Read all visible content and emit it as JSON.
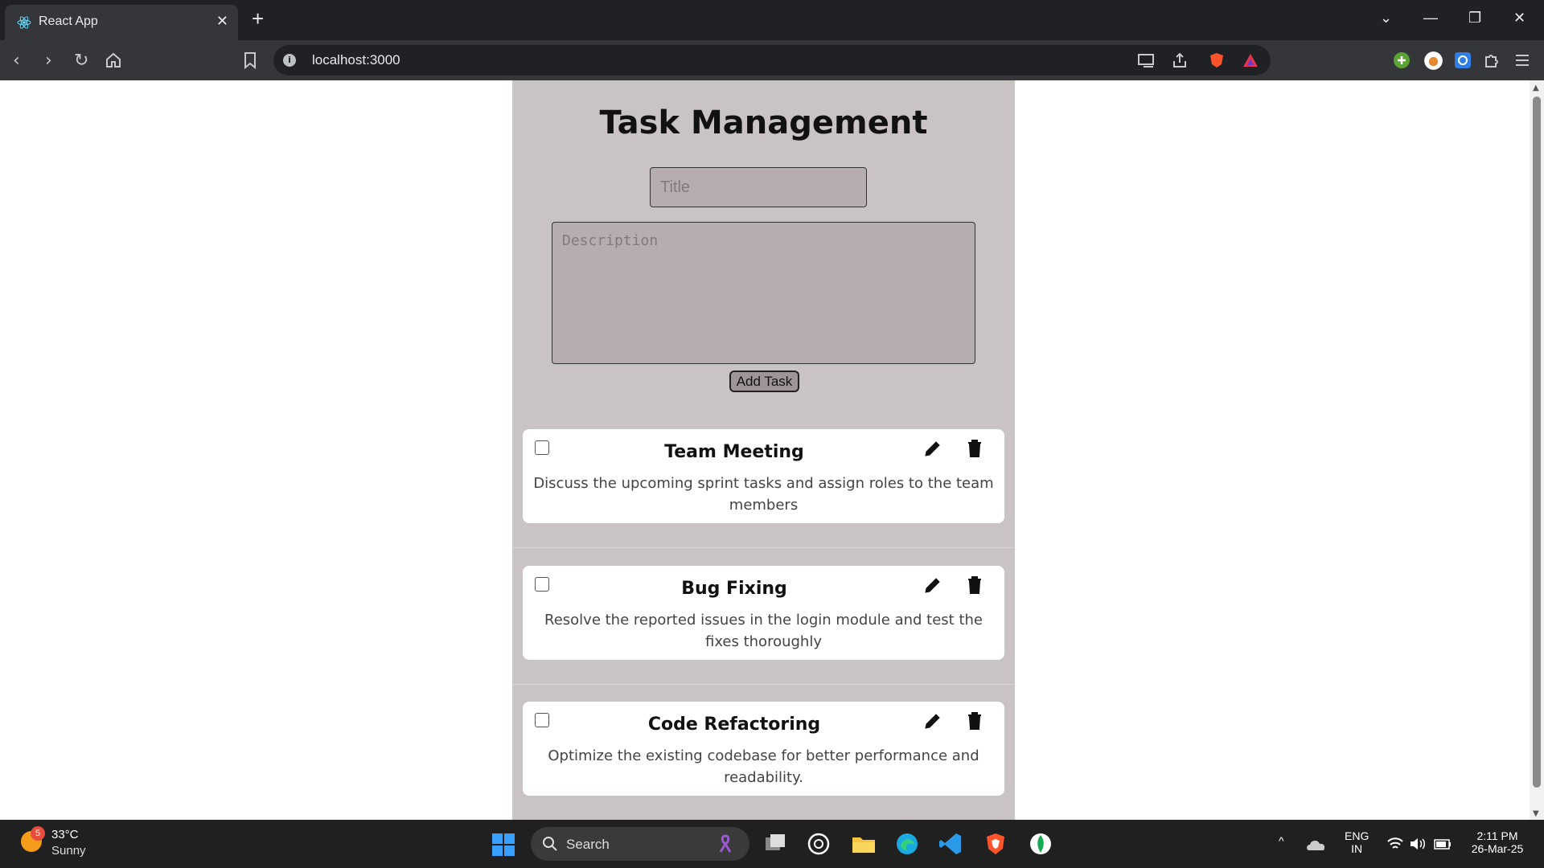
{
  "browser": {
    "tab_title": "React App",
    "tab_close": "✕",
    "new_tab": "+",
    "url": "localhost:3000"
  },
  "app": {
    "heading": "Task Management",
    "title_placeholder": "Title",
    "description_placeholder": "Description",
    "add_button": "Add Task",
    "tasks": [
      {
        "title": "Team Meeting",
        "description": "Discuss the upcoming sprint tasks and assign roles to the team members",
        "completed": false
      },
      {
        "title": "Bug Fixing",
        "description": "Resolve the reported issues in the login module and test the fixes thoroughly",
        "completed": false
      },
      {
        "title": "Code Refactoring",
        "description": "Optimize the existing codebase for better performance and readability.",
        "completed": false
      }
    ]
  },
  "taskbar": {
    "weather_badge": "5",
    "temperature": "33°C",
    "condition": "Sunny",
    "search_label": "Search",
    "lang_1": "ENG",
    "lang_2": "IN",
    "time": "2:11 PM",
    "date": "26-Mar-25"
  },
  "colors": {
    "app_bg": "#c9c3c4",
    "input_bg": "#b5adae",
    "card_bg": "#ffffff",
    "taskbar_bg": "#202020"
  }
}
